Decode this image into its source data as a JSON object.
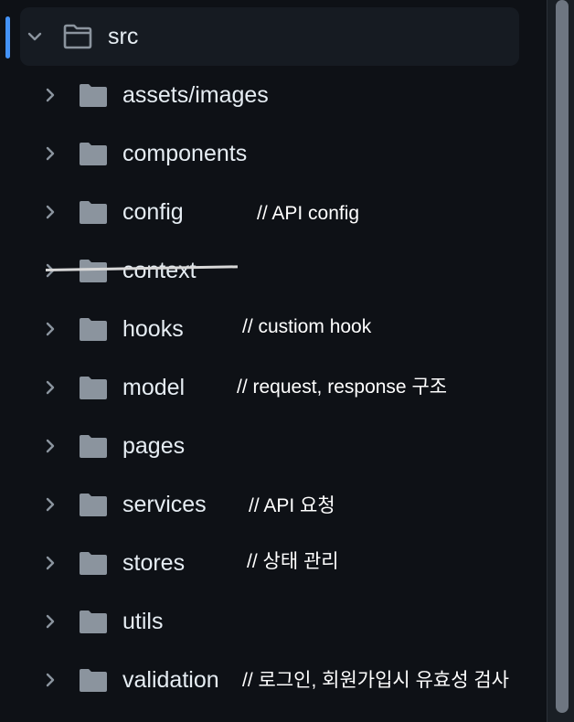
{
  "root": {
    "name": "src",
    "expanded": true,
    "icon": "folder-icon",
    "chevron": "chevron-down-icon"
  },
  "folders": [
    {
      "name": "assets/images",
      "note": ""
    },
    {
      "name": "components",
      "note": ""
    },
    {
      "name": "config",
      "note": "// API config"
    },
    {
      "name": "context",
      "note": "",
      "struck_through": true
    },
    {
      "name": "hooks",
      "note": "// custiom hook"
    },
    {
      "name": "model",
      "note": "// request, response 구조"
    },
    {
      "name": "pages",
      "note": ""
    },
    {
      "name": "services",
      "note": "// API 요청"
    },
    {
      "name": "stores",
      "note": "// 상태 관리"
    },
    {
      "name": "utils",
      "note": ""
    },
    {
      "name": "validation",
      "note": "// 로그인, 회원가입시 유효성 검사"
    }
  ],
  "colors": {
    "background": "#0e1116",
    "selected_row": "#161b22",
    "active_indicator": "#4493f8",
    "folder_icon": "#8b949e",
    "text": "#e6edf3",
    "annotation": "#ffffff",
    "scrollbar_thumb": "#6e7681"
  }
}
